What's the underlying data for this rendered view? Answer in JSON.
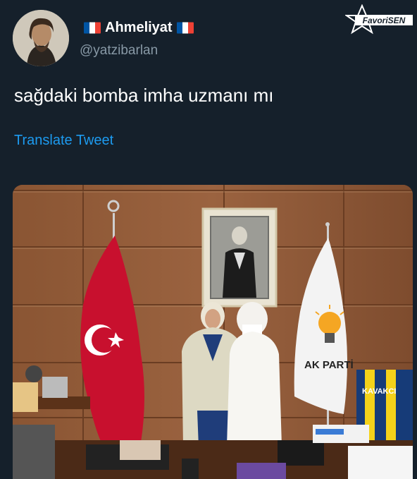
{
  "author": {
    "name": "Ahmeliyat",
    "handle": "@yatzibarlan",
    "flag_icon": "france-flag-icon"
  },
  "watermark": {
    "text": "FavoriSEN"
  },
  "tweet": {
    "text": "sağdaki bomba imha uzmanı mı",
    "translate_label": "Translate Tweet"
  },
  "photo": {
    "party_sign": "AK PARTİ",
    "jersey_text": "KAVAKCI"
  },
  "colors": {
    "background": "#15202b",
    "link": "#1d9bf0",
    "muted": "#8899a6"
  }
}
